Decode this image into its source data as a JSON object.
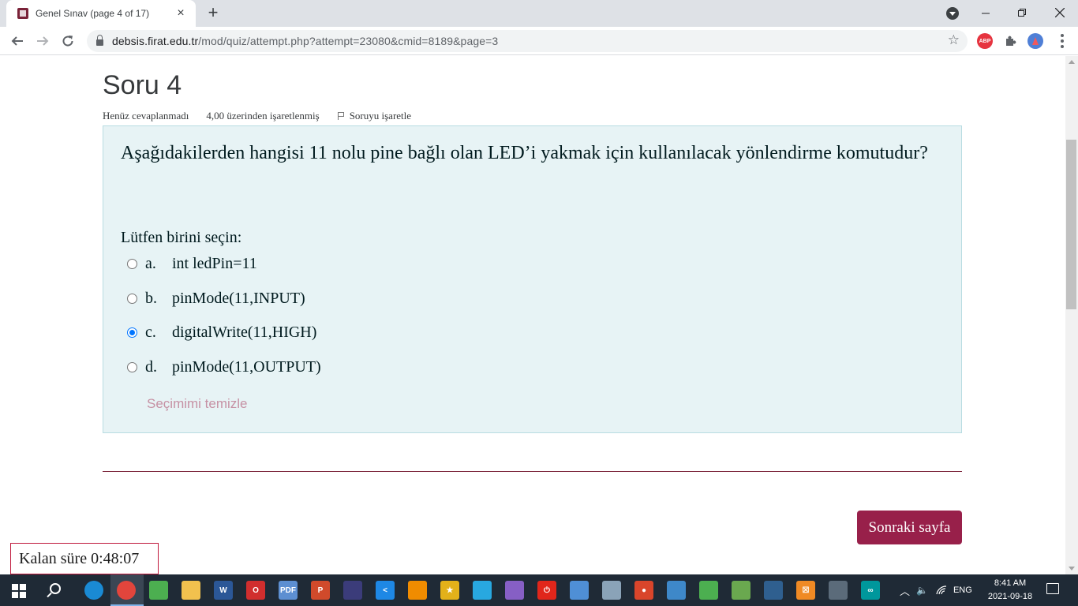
{
  "browser": {
    "tab_title": "Genel Sınav (page 4 of 17)",
    "tab_close": "×",
    "new_tab": "+",
    "url_host": "debsis.firat.edu.tr",
    "url_path": "/mod/quiz/attempt.php?attempt=23080&cmid=8189&page=3",
    "extensions": [
      {
        "name": "adblock-plus-icon",
        "label": "ABP",
        "color": "#e6343f"
      },
      {
        "name": "puzzle-extensions-icon",
        "label": "",
        "color": "#5f6368"
      },
      {
        "name": "profile-avatar-icon",
        "label": "",
        "color": "#4f7fd6"
      }
    ]
  },
  "quiz": {
    "heading": "Soru 4",
    "status": "Henüz cevaplanmadı",
    "marks": "4,00 üzerinden işaretlenmiş",
    "flag_label": "Soruyu işaretle",
    "question_text": "Aşağıdakilerden hangisi 11 nolu pine bağlı olan LED’i yakmak için kullanılacak yönlendirme komutudur?",
    "prompt": "Lütfen birini seçin:",
    "answers": [
      {
        "letter": "a.",
        "text": "int ledPin=11",
        "selected": false
      },
      {
        "letter": "b.",
        "text": "pinMode(11,INPUT)",
        "selected": false
      },
      {
        "letter": "c.",
        "text": "digitalWrite(11,HIGH)",
        "selected": true
      },
      {
        "letter": "d.",
        "text": "pinMode(11,OUTPUT)",
        "selected": false
      }
    ],
    "clear_choice": "Seçimimi temizle",
    "next_button": "Sonraki sayfa",
    "timer_label": "Kalan süre 0:48:07"
  },
  "taskbar": {
    "language": "ENG",
    "time": "8:41 AM",
    "date": "2021-09-18",
    "apps": [
      {
        "name": "edge-icon",
        "color": "#1a8ad4",
        "label": ""
      },
      {
        "name": "chrome-icon",
        "color": "#e2453c",
        "label": ""
      },
      {
        "name": "app-diamond-icon",
        "color": "#4caf50",
        "label": ""
      },
      {
        "name": "file-explorer-icon",
        "color": "#f2c14e",
        "label": ""
      },
      {
        "name": "word-icon",
        "color": "#2b5797",
        "label": "W"
      },
      {
        "name": "opera-icon",
        "color": "#d12e2e",
        "label": "O"
      },
      {
        "name": "pdf-tool-icon",
        "color": "#5d8fd1",
        "label": "PDF"
      },
      {
        "name": "powerpoint-icon",
        "color": "#d04a2b",
        "label": "P"
      },
      {
        "name": "eclipse-icon",
        "color": "#3b3c7a",
        "label": ""
      },
      {
        "name": "vscode-icon",
        "color": "#1e88e5",
        "label": "<"
      },
      {
        "name": "vlc-icon",
        "color": "#f08c00",
        "label": ""
      },
      {
        "name": "star-app-icon",
        "color": "#e3b11a",
        "label": "★"
      },
      {
        "name": "send-app-icon",
        "color": "#28a8e0",
        "label": ""
      },
      {
        "name": "visual-studio-icon",
        "color": "#865fc5",
        "label": ""
      },
      {
        "name": "power-app-icon",
        "color": "#e0261b",
        "label": "⏻"
      },
      {
        "name": "control-panel-icon",
        "color": "#4f8fd6",
        "label": ""
      },
      {
        "name": "paint-icon",
        "color": "#8aa3b8",
        "label": ""
      },
      {
        "name": "recorder-icon",
        "color": "#d9452b",
        "label": "●"
      },
      {
        "name": "network-tool-icon",
        "color": "#3e88c9",
        "label": ""
      },
      {
        "name": "python-ide-icon",
        "color": "#4caf50",
        "label": ""
      },
      {
        "name": "chart-tool-icon",
        "color": "#6aa84f",
        "label": ""
      },
      {
        "name": "sql-tool-icon",
        "color": "#2f5f8f",
        "label": ""
      },
      {
        "name": "xampp-icon",
        "color": "#f08a24",
        "label": "☒"
      },
      {
        "name": "image-viewer-icon",
        "color": "#5b6b7a",
        "label": ""
      },
      {
        "name": "arduino-icon",
        "color": "#00979c",
        "label": "∞"
      }
    ]
  }
}
